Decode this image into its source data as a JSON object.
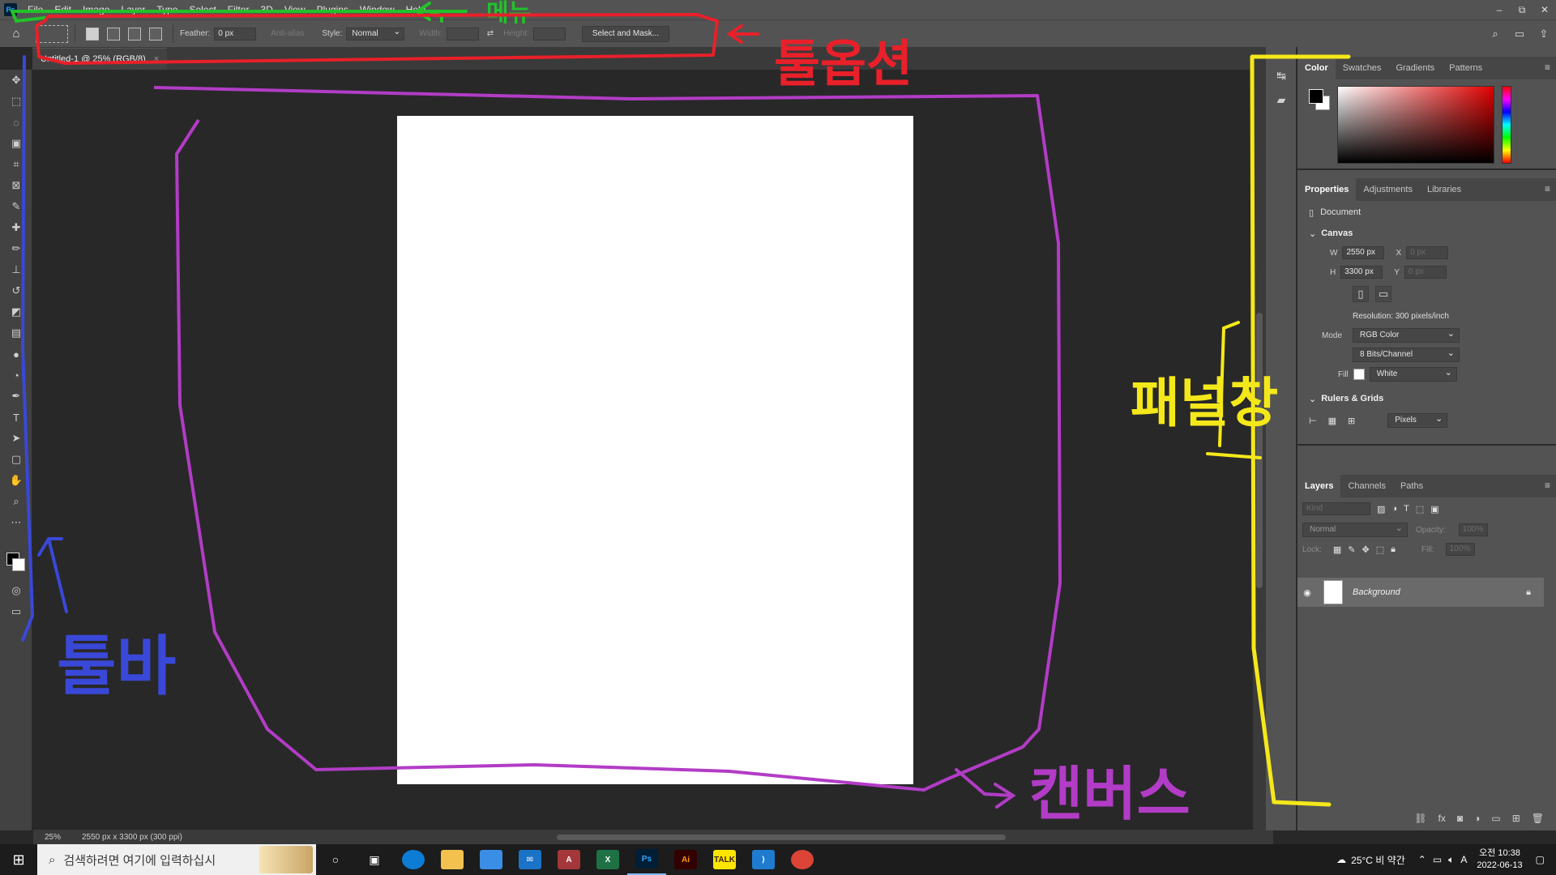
{
  "app": {
    "logo": "Ps"
  },
  "menu": [
    "File",
    "Edit",
    "Image",
    "Layer",
    "Type",
    "Select",
    "Filter",
    "3D",
    "View",
    "Plugins",
    "Window",
    "Help"
  ],
  "window_controls": {
    "minimize": "–",
    "restore": "⧉",
    "close": "✕"
  },
  "options_bar": {
    "feather_label": "Feather:",
    "feather_value": "0 px",
    "antialias_label": "Anti-alias",
    "style_label": "Style:",
    "style_value": "Normal",
    "width_label": "Width:",
    "height_label": "Height:",
    "select_mask_label": "Select and Mask..."
  },
  "document": {
    "tab_title": "Untitled-1 @ 25% (RGB/8)",
    "close": "×"
  },
  "status": {
    "zoom": "25%",
    "info": "2550 px x 3300 px (300 ppi)"
  },
  "color_panel": {
    "tabs": [
      "Color",
      "Swatches",
      "Gradients",
      "Patterns"
    ],
    "active": "Color"
  },
  "properties_panel": {
    "tabs": [
      "Properties",
      "Adjustments",
      "Libraries"
    ],
    "document_label": "Document",
    "canvas_heading": "Canvas",
    "w_label": "W",
    "w_value": "2550 px",
    "h_label": "H",
    "h_value": "3300 px",
    "x_label": "X",
    "x_placeholder": "0 px",
    "y_label": "Y",
    "y_placeholder": "0 px",
    "resolution": "Resolution: 300 pixels/inch",
    "mode_label": "Mode",
    "mode_value": "RGB Color",
    "bits_value": "8 Bits/Channel",
    "fill_label": "Fill",
    "fill_value": "White",
    "rulers_heading": "Rulers & Grids",
    "units_value": "Pixels"
  },
  "layers_panel": {
    "tabs": [
      "Layers",
      "Channels",
      "Paths"
    ],
    "kind_placeholder": "Kind",
    "blend_mode": "Normal",
    "opacity_label": "Opacity:",
    "opacity_value": "100%",
    "lock_label": "Lock:",
    "fill_label": "Fill:",
    "fill_value": "100%",
    "layer_name": "Background"
  },
  "taskbar": {
    "search_placeholder": "검색하려면 여기에 입력하십시",
    "weather": "25°C  비 약간",
    "time": "오전 10:38",
    "date": "2022-06-13",
    "ime": "A"
  },
  "annotations": {
    "menu_label": "메뉴",
    "options_label": "툴옵션",
    "toolbar_label": "툴바",
    "panel_label": "패널창",
    "canvas_label": "캔버스"
  },
  "colors": {
    "ui_bg": "#535353",
    "canvas_bg": "#282828",
    "green_annot": "#22c22a",
    "red_annot": "#e8202a",
    "blue_annot": "#3a48d8",
    "purple_annot": "#b23cc6",
    "yellow_annot": "#f4e81a"
  }
}
